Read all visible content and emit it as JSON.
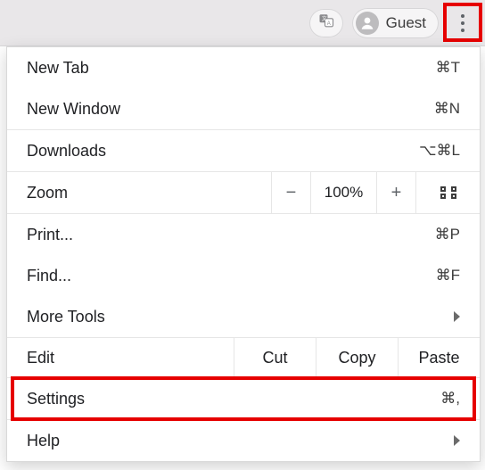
{
  "toolbar": {
    "guest_label": "Guest"
  },
  "menu": {
    "new_tab": {
      "label": "New Tab",
      "shortcut": "⌘T"
    },
    "new_window": {
      "label": "New Window",
      "shortcut": "⌘N"
    },
    "downloads": {
      "label": "Downloads",
      "shortcut": "⌥⌘L"
    },
    "zoom": {
      "label": "Zoom",
      "value": "100%",
      "minus": "−",
      "plus": "+"
    },
    "print": {
      "label": "Print...",
      "shortcut": "⌘P"
    },
    "find": {
      "label": "Find...",
      "shortcut": "⌘F"
    },
    "more_tools": {
      "label": "More Tools"
    },
    "edit": {
      "label": "Edit",
      "cut": "Cut",
      "copy": "Copy",
      "paste": "Paste"
    },
    "settings": {
      "label": "Settings",
      "shortcut": "⌘,"
    },
    "help": {
      "label": "Help"
    }
  }
}
